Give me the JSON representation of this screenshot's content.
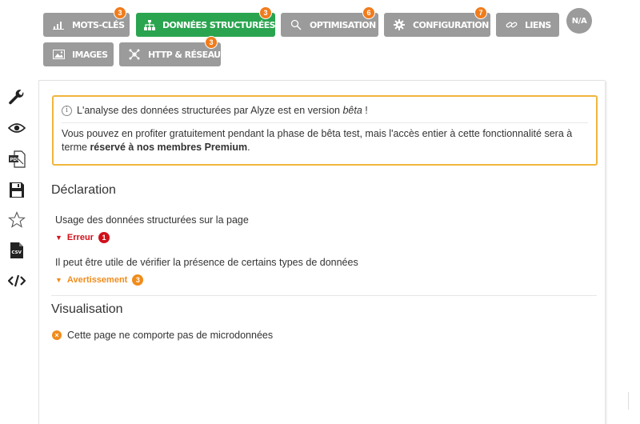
{
  "tabs": [
    {
      "label": "MOTS-CLÉS",
      "badge": "3",
      "icon": "bar-chart-icon",
      "active": false
    },
    {
      "label": "DONNÉES STRUCTURÉES",
      "badge": "3",
      "icon": "sitemap-icon",
      "active": true
    },
    {
      "label": "OPTIMISATION",
      "badge": "6",
      "icon": "magnifier-icon",
      "active": false
    },
    {
      "label": "CONFIGURATION",
      "badge": "7",
      "icon": "gear-icon",
      "active": false
    },
    {
      "label": "LIENS",
      "badge": "",
      "icon": "link-icon",
      "active": false
    },
    {
      "label": "IMAGES",
      "badge": "",
      "icon": "image-icon",
      "active": false
    },
    {
      "label": "HTTP & RÉSEAU",
      "badge": "3",
      "icon": "network-icon",
      "active": false
    }
  ],
  "score_badge": "N/A",
  "side_tools": [
    "wrench-icon",
    "eye-icon",
    "pdf-icon",
    "save-icon",
    "star-icon",
    "csv-icon",
    "code-icon"
  ],
  "side_tool_labels": {
    "pdf": "PDF",
    "csv": "CSV"
  },
  "notice": {
    "info_symbol": "i",
    "intro": "L'analyse des données structurées par Alyze est en version ",
    "beta": "bêta",
    "intro_end": " !",
    "body_prefix": "Vous pouvez en profiter gratuitement pendant la phase de bêta test, mais l'accès entier à cette fonctionnalité sera à terme ",
    "body_bold": "réservé à nos membres Premium",
    "body_suffix": "."
  },
  "declaration": {
    "title": "Déclaration",
    "checks": [
      {
        "label": "Usage des données structurées sur la page",
        "status": "Erreur",
        "count": "1",
        "level": "error"
      },
      {
        "label": "Il peut être utile de vérifier la présence de certains types de données",
        "status": "Avertissement",
        "count": "3",
        "level": "warning"
      }
    ]
  },
  "visualisation": {
    "title": "Visualisation",
    "message": "Cette page ne comporte pas de microdonnées",
    "icon_symbol": "×"
  },
  "status_marker": "▼",
  "colors": {
    "tab_gray": "#9b9b9b",
    "tab_active": "#2aa44f",
    "badge_orange": "#f07c1c",
    "error_red": "#d0111b",
    "warning_orange": "#f08c1c",
    "notice_border": "#f0b63c"
  }
}
